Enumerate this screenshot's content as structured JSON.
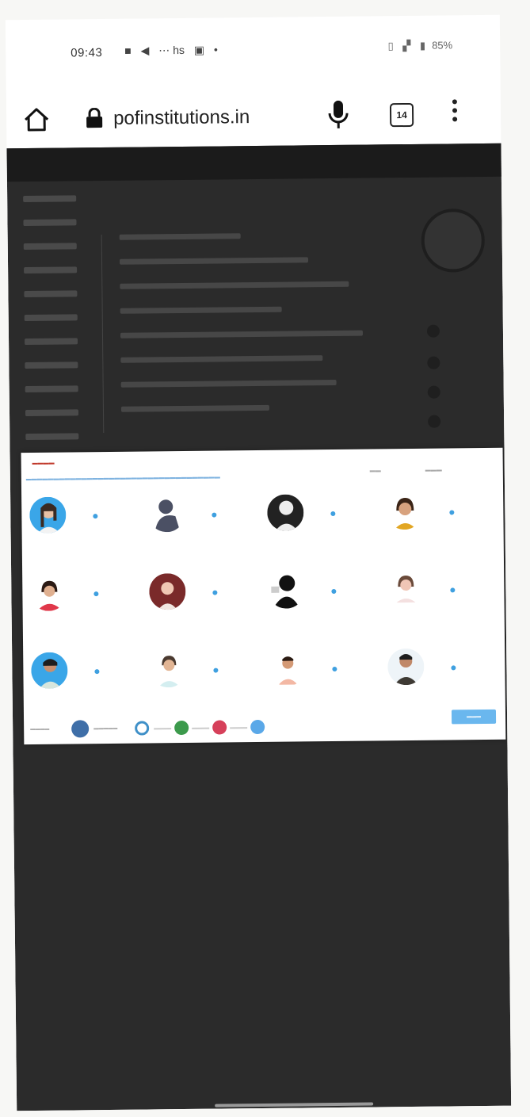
{
  "status_bar": {
    "time": "09:43",
    "left_icons": [
      "notification-icon",
      "telegram-icon",
      "hs",
      "message-icon",
      "dot"
    ],
    "right_text": "85%"
  },
  "browser": {
    "url": "pofinstitutions.in",
    "tab_count": "14"
  },
  "colors": {
    "seat_dot": "#3fa0e0",
    "next_button": "#6ab7ee",
    "legend": [
      "#3f6fa8",
      "#3f90c8",
      "#3c9a4c",
      "#d6405a",
      "#5aa8e8"
    ]
  },
  "modal": {
    "profiles": [
      {
        "row": 0,
        "col": 0,
        "kind": "girl-blue-bg"
      },
      {
        "row": 0,
        "col": 1,
        "kind": "silhouette-grey"
      },
      {
        "row": 0,
        "col": 2,
        "kind": "silhouette-dark"
      },
      {
        "row": 0,
        "col": 3,
        "kind": "girl-yellow"
      },
      {
        "row": 1,
        "col": 0,
        "kind": "girl-red"
      },
      {
        "row": 1,
        "col": 1,
        "kind": "girl-maroon-bg"
      },
      {
        "row": 1,
        "col": 2,
        "kind": "silhouette-black"
      },
      {
        "row": 1,
        "col": 3,
        "kind": "girl-faint"
      },
      {
        "row": 2,
        "col": 0,
        "kind": "boy-blue-bg"
      },
      {
        "row": 2,
        "col": 1,
        "kind": "girl-plain"
      },
      {
        "row": 2,
        "col": 2,
        "kind": "boy-beard"
      },
      {
        "row": 2,
        "col": 3,
        "kind": "boy-dark-shirt"
      }
    ]
  }
}
